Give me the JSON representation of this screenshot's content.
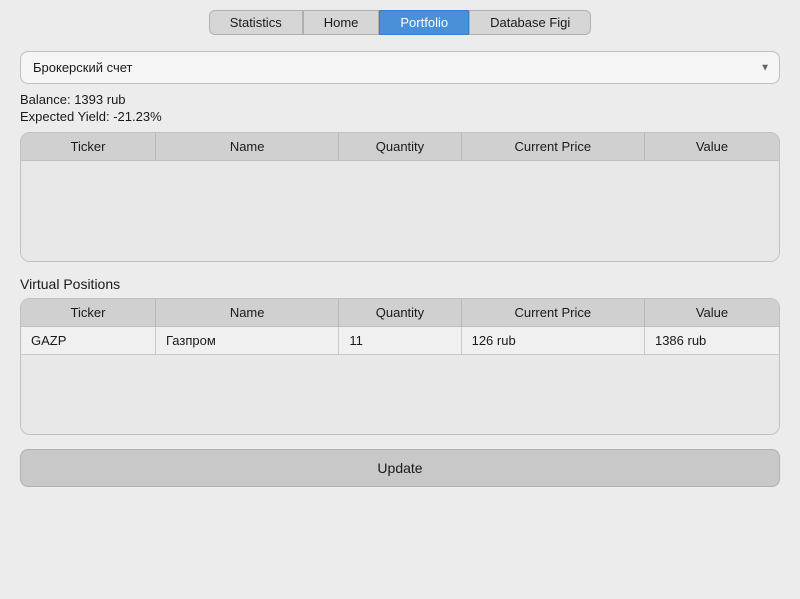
{
  "nav": {
    "tabs": [
      {
        "id": "statistics",
        "label": "Statistics",
        "active": false
      },
      {
        "id": "home",
        "label": "Home",
        "active": false
      },
      {
        "id": "portfolio",
        "label": "Portfolio",
        "active": true
      },
      {
        "id": "database-figi",
        "label": "Database Figi",
        "active": false
      }
    ]
  },
  "broker": {
    "selected": "Брокерский счет",
    "placeholder": "Брокерский счет"
  },
  "portfolio": {
    "balance_label": "Balance: 1393 rub",
    "yield_label": "Expected Yield: -21.23%"
  },
  "positions_table": {
    "columns": [
      "Ticker",
      "Name",
      "Quantity",
      "Current Price",
      "Value"
    ],
    "rows": []
  },
  "virtual_positions": {
    "header": "Virtual Positions",
    "columns": [
      "Ticker",
      "Name",
      "Quantity",
      "Current Price",
      "Value"
    ],
    "rows": [
      {
        "ticker": "GAZP",
        "name": "Газпром",
        "quantity": "11",
        "current_price": "126 rub",
        "value": "1386 rub"
      }
    ]
  },
  "update_button": {
    "label": "Update"
  }
}
